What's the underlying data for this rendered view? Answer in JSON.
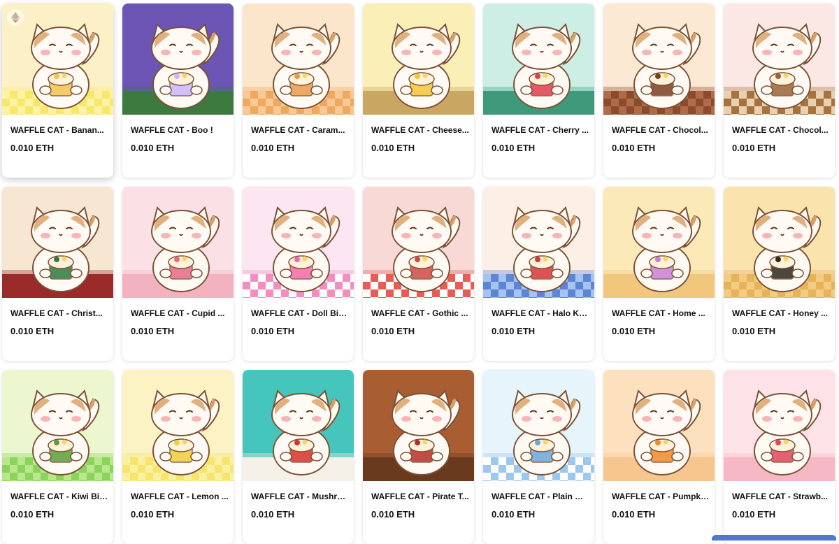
{
  "collection": {
    "items": [
      {
        "title": "WAFFLE CAT - Banan...",
        "price": "0.010 ETH",
        "bg": "#fcf1c6",
        "floor": "#f8e86a",
        "floor2": "#fcf3a8",
        "check": true,
        "accent": "#f3c44b",
        "icon": "ethereum-icon"
      },
      {
        "title": "WAFFLE CAT - Boo !",
        "price": "0.010 ETH",
        "bg": "#6c55b5",
        "floor": "#3c7a3f",
        "floor2": "#4e9152",
        "check": false,
        "accent": "#c9b6ff"
      },
      {
        "title": "WAFFLE CAT - Caram...",
        "price": "0.010 ETH",
        "bg": "#fbe6cc",
        "floor": "#f0a760",
        "floor2": "#f8c994",
        "check": true,
        "accent": "#e89b4b"
      },
      {
        "title": "WAFFLE CAT - Cheese...",
        "price": "0.010 ETH",
        "bg": "#fbefb8",
        "floor": "#c9a661",
        "floor2": "#e2c586",
        "check": false,
        "accent": "#f5c637"
      },
      {
        "title": "WAFFLE CAT - Cherry ...",
        "price": "0.010 ETH",
        "bg": "#cdeee5",
        "floor": "#3f9a7b",
        "floor2": "#5fb596",
        "check": false,
        "accent": "#e23b4b"
      },
      {
        "title": "WAFFLE CAT - Chocol...",
        "price": "0.010 ETH",
        "bg": "#fbe9d4",
        "floor": "#8d4b2e",
        "floor2": "#b06b48",
        "check": true,
        "accent": "#7b3f23"
      },
      {
        "title": "WAFFLE CAT - Chocol...",
        "price": "0.010 ETH",
        "bg": "#fbe8e5",
        "floor": "#a6733f",
        "floor2": "#e8d0b0",
        "check": true,
        "accent": "#9b6436"
      },
      {
        "title": "WAFFLE CAT - Christ...",
        "price": "0.010 ETH",
        "bg": "#f6e6d2",
        "floor": "#9b2a2a",
        "floor2": "#b84040",
        "check": false,
        "accent": "#2f7a3c"
      },
      {
        "title": "WAFFLE CAT - Cupid ...",
        "price": "0.010 ETH",
        "bg": "#fbe1e6",
        "floor": "#f3b2bf",
        "floor2": "#f8cbd4",
        "check": false,
        "accent": "#e46a86"
      },
      {
        "title": "WAFFLE CAT - Doll Bin...",
        "price": "0.010 ETH",
        "bg": "#fce6f1",
        "floor": "#f58dc0",
        "floor2": "#ffffff",
        "check": true,
        "accent": "#f26aa8"
      },
      {
        "title": "WAFFLE CAT - Gothic ...",
        "price": "0.010 ETH",
        "bg": "#f9d9d6",
        "floor": "#e95c56",
        "floor2": "#ffffff",
        "check": true,
        "accent": "#d04a44"
      },
      {
        "title": "WAFFLE CAT - Halo Kit...",
        "price": "0.010 ETH",
        "bg": "#fbefe6",
        "floor": "#5b86d6",
        "floor2": "#a8c3f0",
        "check": true,
        "accent": "#d9353b"
      },
      {
        "title": "WAFFLE CAT - Home ...",
        "price": "0.010 ETH",
        "bg": "#fbe9b8",
        "floor": "#f1c77e",
        "floor2": "#f8dda6",
        "check": false,
        "accent": "#c97fd7"
      },
      {
        "title": "WAFFLE CAT - Honey ...",
        "price": "0.010 ETH",
        "bg": "#fbe3ae",
        "floor": "#e6b35b",
        "floor2": "#f2cc83",
        "check": true,
        "accent": "#2d2a1f"
      },
      {
        "title": "WAFFLE CAT - Kiwi Bin...",
        "price": "0.010 ETH",
        "bg": "#ecf7cf",
        "floor": "#8bd35b",
        "floor2": "#b9e78b",
        "check": true,
        "accent": "#5aa03a"
      },
      {
        "title": "WAFFLE CAT - Lemon ...",
        "price": "0.010 ETH",
        "bg": "#fcf3c4",
        "floor": "#f6e46c",
        "floor2": "#faf0a2",
        "check": true,
        "accent": "#f0cf3a"
      },
      {
        "title": "WAFFLE CAT - Mushro...",
        "price": "0.010 ETH",
        "bg": "#45c5bb",
        "floor": "#f5f0e8",
        "floor2": "#e4ddd0",
        "check": false,
        "accent": "#d8322b"
      },
      {
        "title": "WAFFLE CAT - Pirate T...",
        "price": "0.010 ETH",
        "bg": "#a95d33",
        "floor": "#6a3a1f",
        "floor2": "#83502e",
        "check": false,
        "accent": "#b82f2a"
      },
      {
        "title": "WAFFLE CAT - Plain Mi...",
        "price": "0.010 ETH",
        "bg": "#e6f4fb",
        "floor": "#9cc8ee",
        "floor2": "#ffffff",
        "check": true,
        "accent": "#6aa7dc"
      },
      {
        "title": "WAFFLE CAT - Pumpki...",
        "price": "0.010 ETH",
        "bg": "#fde0bd",
        "floor": "#f6c68e",
        "floor2": "#f9d6ac",
        "check": false,
        "accent": "#f08a2b"
      },
      {
        "title": "WAFFLE CAT - Strawb...",
        "price": "0.010 ETH",
        "bg": "#fde3e8",
        "floor": "#f5b8c4",
        "floor2": "#f9ccd5",
        "check": false,
        "accent": "#e2465d"
      }
    ]
  }
}
